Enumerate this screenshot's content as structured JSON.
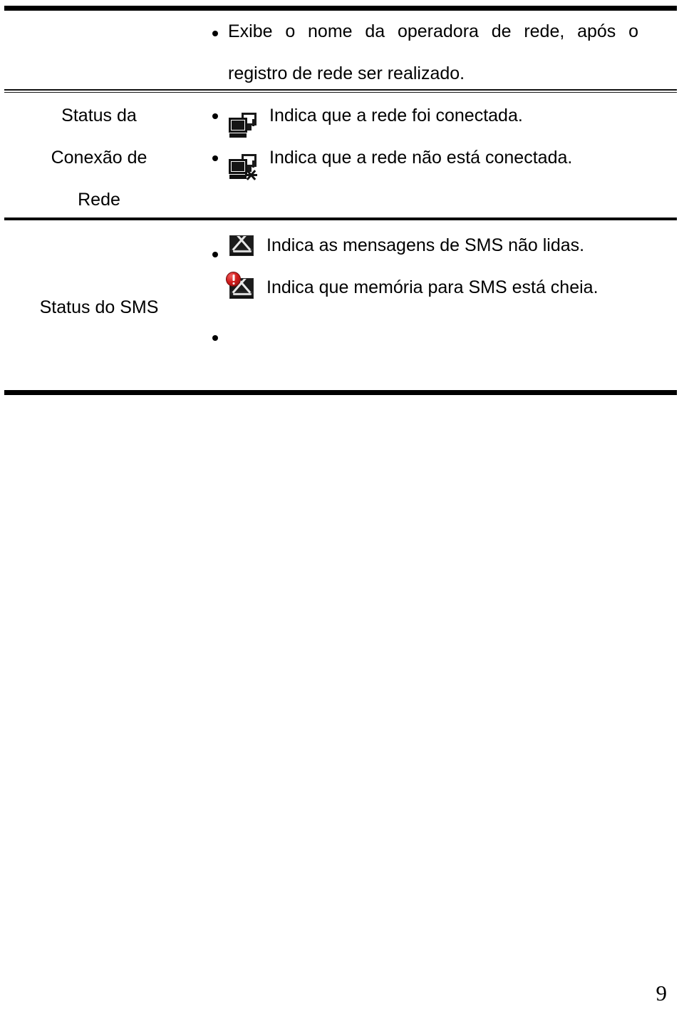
{
  "document": {
    "page_number": "9"
  },
  "table": {
    "rows": [
      {
        "label_lines": [],
        "items": [
          {
            "bullet": true,
            "icon": null,
            "text": "Exibe o nome da operadora de rede, após o registro de rede ser realizado."
          }
        ]
      },
      {
        "label_lines": [
          "Status da",
          "Conexão de",
          "Rede"
        ],
        "items": [
          {
            "bullet": true,
            "icon": "network-connected-icon",
            "text": "Indica que a rede foi conectada."
          },
          {
            "bullet": true,
            "icon": "network-disconnected-icon",
            "text": "Indica que a rede não está conectada."
          }
        ]
      },
      {
        "label_lines": [
          "Status do SMS"
        ],
        "items": [
          {
            "bullet": true,
            "icon": "sms-unread-icon",
            "text": "Indica as mensagens de SMS não lidas."
          },
          {
            "bullet": true,
            "icon": "sms-memory-full-icon",
            "text": "Indica que memória para SMS está cheia."
          }
        ]
      }
    ]
  },
  "colors": {
    "rule": "#000000",
    "text": "#000000",
    "warning_badge": "#d01c1c",
    "icon_dark": "#1b1b1b",
    "page_background": "#ffffff"
  }
}
